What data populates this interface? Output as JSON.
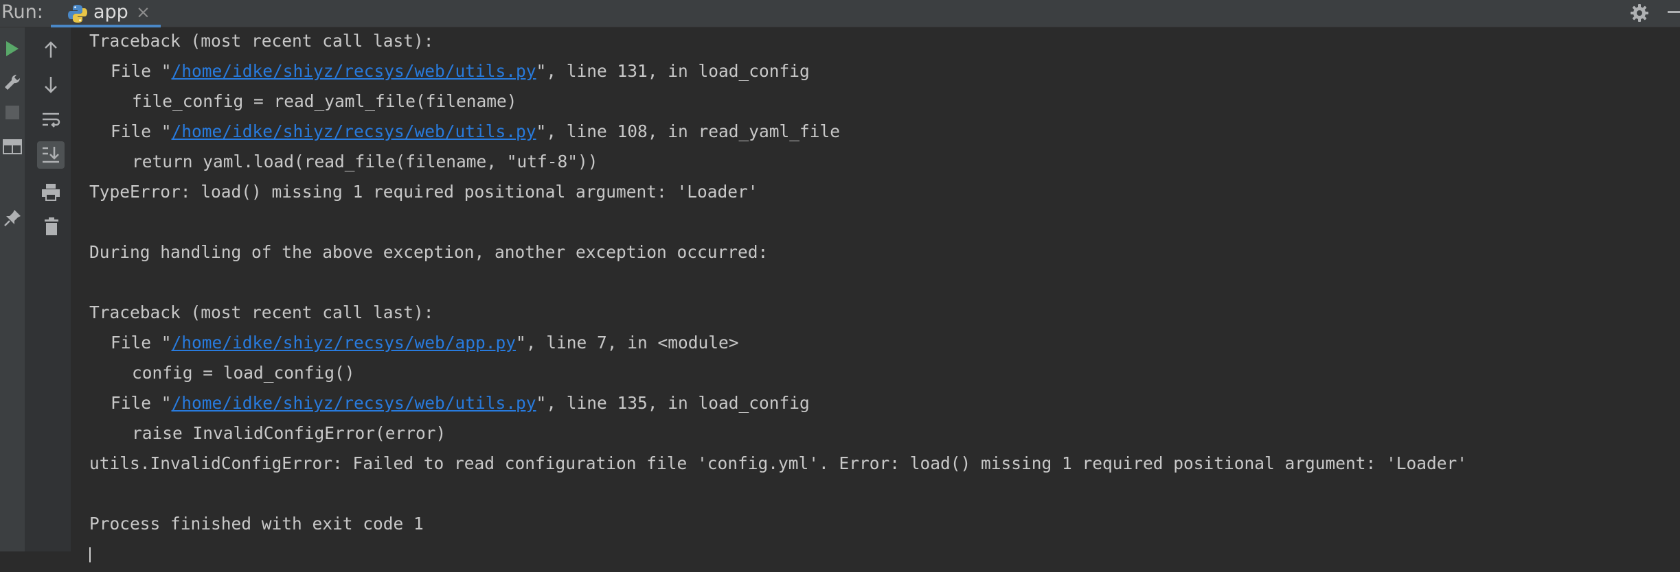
{
  "run_label": "Run:",
  "tab": {
    "label": "app",
    "close": "×"
  },
  "left_bar_icons": [
    "run-icon",
    "wrench-icon",
    "stop-icon",
    "layout-icon",
    "pin-icon"
  ],
  "toolbar_icons": [
    "up-arrow-icon",
    "down-arrow-icon",
    "soft-wrap-icon",
    "scroll-to-end-icon",
    "print-icon",
    "trash-icon"
  ],
  "colors": {
    "background": "#2b2b2b",
    "text": "#c8c8c8",
    "link": "#287bde",
    "run_green": "#59a869",
    "tab_underline": "#4a88c7"
  },
  "console": {
    "l1": "Traceback (most recent call last):",
    "l2_pre": "File \"",
    "l2_link": "/home/idke/shiyz/recsys/web/utils.py",
    "l2_post": "\", line 131, in load_config",
    "l3": "file_config = read_yaml_file(filename)",
    "l4_pre": "File \"",
    "l4_link": "/home/idke/shiyz/recsys/web/utils.py",
    "l4_post": "\", line 108, in read_yaml_file",
    "l5": "return yaml.load(read_file(filename, \"utf-8\"))",
    "l6": "TypeError: load() missing 1 required positional argument: 'Loader'",
    "l8": "During handling of the above exception, another exception occurred:",
    "l10": "Traceback (most recent call last):",
    "l11_pre": "File \"",
    "l11_link": "/home/idke/shiyz/recsys/web/app.py",
    "l11_post": "\", line 7, in <module>",
    "l12": "config = load_config()",
    "l13_pre": "File \"",
    "l13_link": "/home/idke/shiyz/recsys/web/utils.py",
    "l13_post": "\", line 135, in load_config",
    "l14": "raise InvalidConfigError(error)",
    "l15": "utils.InvalidConfigError: Failed to read configuration file 'config.yml'. Error: load() missing 1 required positional argument: 'Loader'",
    "l17": "Process finished with exit code 1"
  }
}
